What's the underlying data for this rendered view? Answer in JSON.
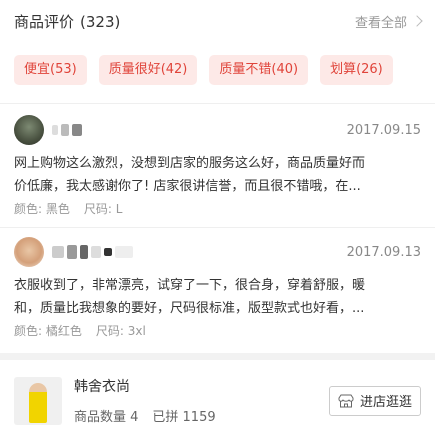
{
  "reviews_section": {
    "title": "商品评价",
    "count": "(323)",
    "see_all": "查看全部",
    "tags": [
      "便宜(53)",
      "质量很好(42)",
      "质量不错(40)",
      "划算(26)"
    ]
  },
  "reviews": [
    {
      "date": "2017.09.15",
      "content_line1": "网上购物这么激烈，没想到店家的服务这么好，商品质量好而",
      "content_line2": "价低廉，我太感谢你了! 店家很讲信誉，而且很不错哦，在...",
      "color_label": "颜色: 黑色",
      "size_label": "尺码: L"
    },
    {
      "date": "2017.09.13",
      "content_line1": "衣服收到了，非常漂亮，试穿了一下，很合身，穿着舒服，暖",
      "content_line2": "和，质量比我想象的要好，尺码很标准，版型款式也好看，...",
      "color_label": "颜色: 橘红色",
      "size_label": "尺码: 3xl"
    }
  ],
  "shop": {
    "name": "韩舍衣尚",
    "product_count": "商品数量 4",
    "sold_count": "已拼 1159",
    "button_label": "进店逛逛"
  }
}
